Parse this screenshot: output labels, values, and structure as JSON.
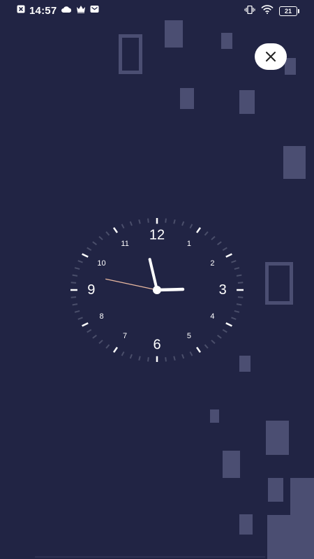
{
  "status_bar": {
    "time": "14:57",
    "battery_level": "21",
    "icons": [
      "sim-off-icon",
      "cloud-icon",
      "crown-icon",
      "mail-icon",
      "vibrate-icon",
      "wifi-icon",
      "battery-icon"
    ]
  },
  "close_button": {
    "icon": "close-icon"
  },
  "clock": {
    "hour": 14,
    "minute": 57,
    "second": 47,
    "numerals_large": [
      "12",
      "3",
      "6",
      "9"
    ],
    "numerals_small": [
      "1",
      "2",
      "4",
      "5",
      "7",
      "8",
      "10",
      "11"
    ],
    "second_hand_color": "#e8b8a0",
    "tick_color_dim": "#4a4e6a"
  },
  "colors": {
    "background": "#212444",
    "decoration": "#4b4e72"
  }
}
